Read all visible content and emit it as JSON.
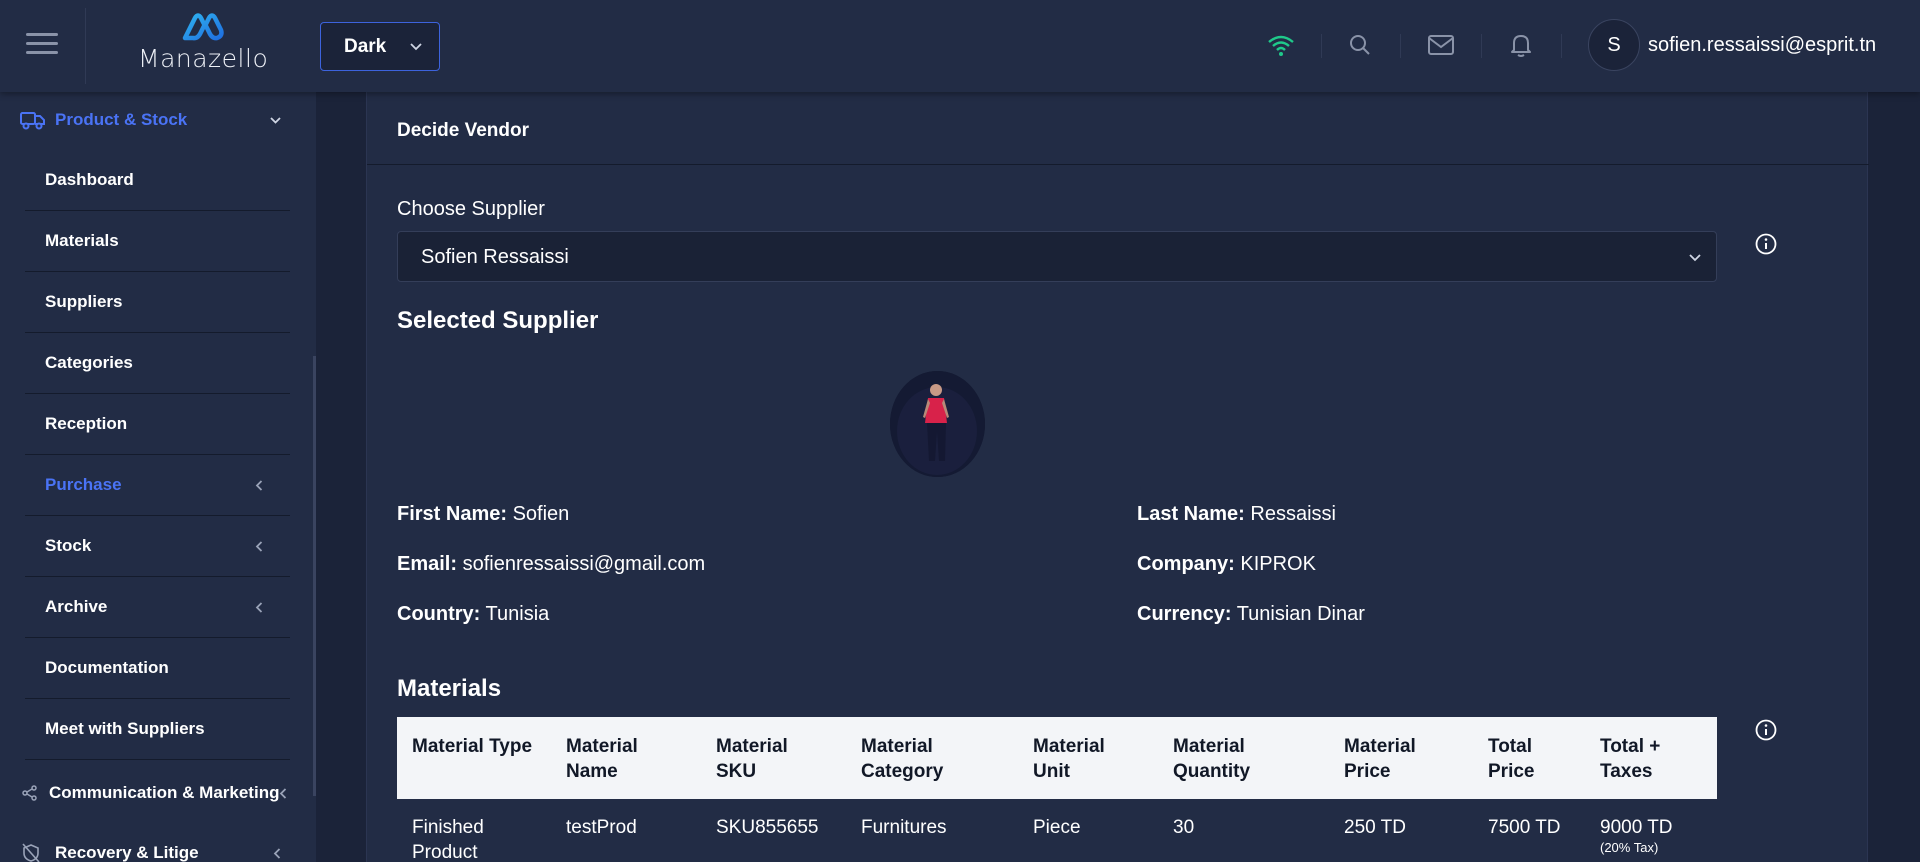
{
  "header": {
    "logo_text": "Manazello",
    "theme": {
      "value": "Dark",
      "options": [
        "Dark"
      ]
    },
    "user": {
      "initial": "S",
      "email": "sofien.ressaissi@esprit.tn"
    },
    "icons": [
      "menu-icon",
      "wifi-icon",
      "search-icon",
      "mail-icon",
      "bell-icon"
    ]
  },
  "sidebar": {
    "section_product": "Product & Stock",
    "items": [
      {
        "label": "Dashboard",
        "has_submenu": false
      },
      {
        "label": "Materials",
        "has_submenu": false
      },
      {
        "label": "Suppliers",
        "has_submenu": false
      },
      {
        "label": "Categories",
        "has_submenu": false
      },
      {
        "label": "Reception",
        "has_submenu": false
      },
      {
        "label": "Purchase",
        "has_submenu": true,
        "active": true
      },
      {
        "label": "Stock",
        "has_submenu": true
      },
      {
        "label": "Archive",
        "has_submenu": true
      },
      {
        "label": "Documentation",
        "has_submenu": false
      },
      {
        "label": "Meet with Suppliers",
        "has_submenu": false
      }
    ],
    "section_communication": "Communication & Marketing",
    "section_recovery": "Recovery & Litige"
  },
  "main": {
    "card_title": "Decide Vendor",
    "choose_supplier_label": "Choose Supplier",
    "supplier_selected": "Sofien Ressaissi",
    "selected_supplier_title": "Selected Supplier",
    "details": {
      "first_name_label": "First Name:",
      "first_name": "Sofien",
      "last_name_label": "Last Name:",
      "last_name": "Ressaissi",
      "email_label": "Email:",
      "email": "sofienressaissi@gmail.com",
      "company_label": "Company:",
      "company": "KIPROK",
      "country_label": "Country:",
      "country": "Tunisia",
      "currency_label": "Currency:",
      "currency": "Tunisian Dinar"
    },
    "materials_title": "Materials",
    "table": {
      "headers": [
        "Material Type",
        "Material Name",
        "Material SKU",
        "Material Category",
        "Material Unit",
        "Material Quantity",
        "Material Price",
        "Total Price",
        "Total + Taxes"
      ],
      "rows": [
        [
          "Finished Product",
          "testProd",
          "SKU855655",
          "Furnitures",
          "Piece",
          "30",
          "250 TD",
          "7500 TD",
          "9000 TD"
        ]
      ],
      "tax_note": "(20% Tax)"
    }
  },
  "colors": {
    "background": "#1b2339",
    "panel": "#222c45",
    "accent": "#4a73f5",
    "wifi_green": "#1fc98a"
  }
}
